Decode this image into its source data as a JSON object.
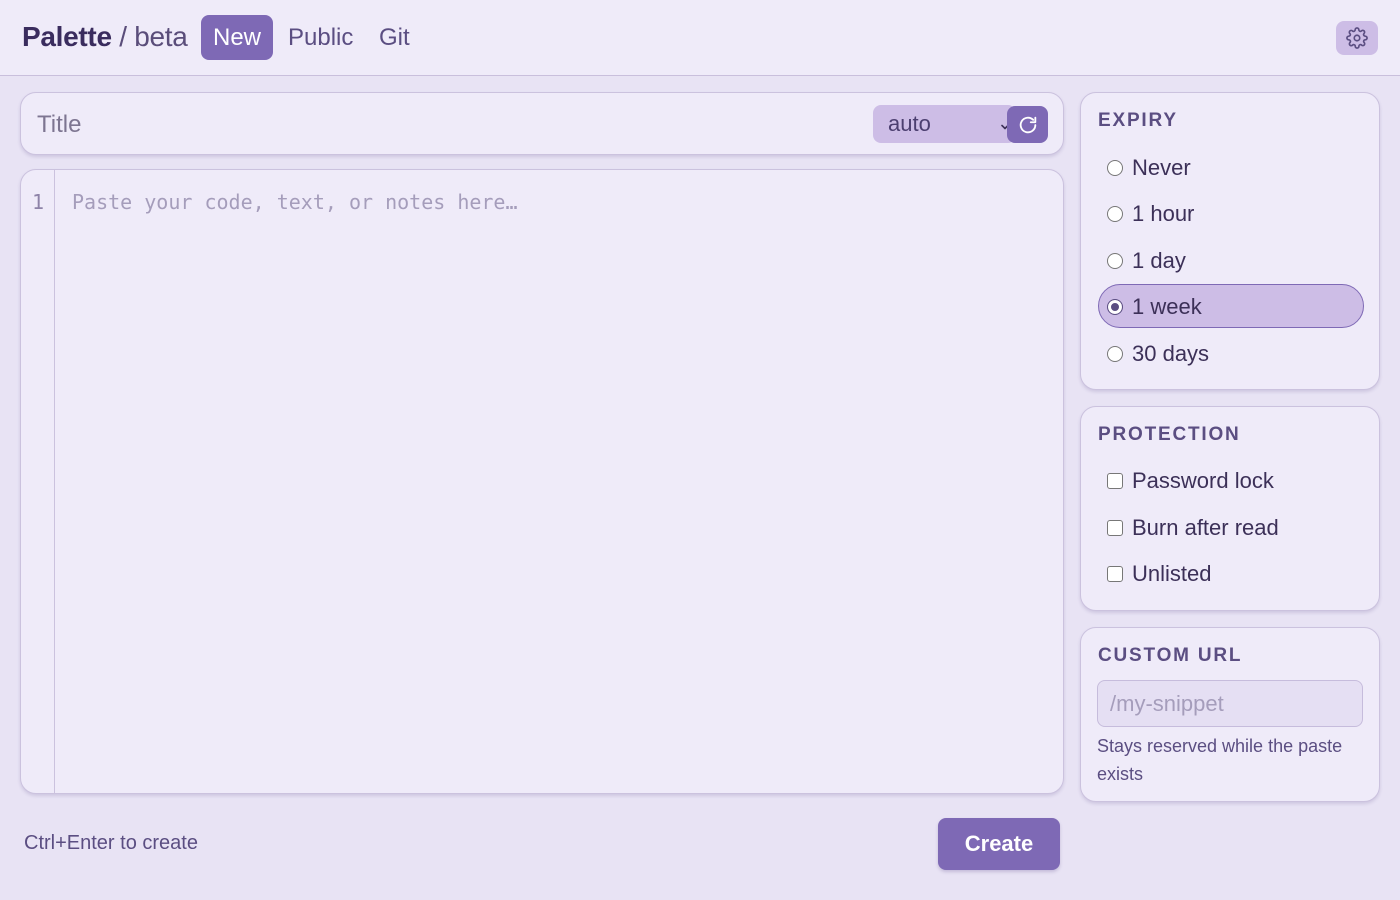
{
  "header": {
    "brand_name": "Palette",
    "brand_sep": " / ",
    "brand_tag": "beta",
    "tabs": [
      {
        "label": "New",
        "active": true
      },
      {
        "label": "Public",
        "active": false
      },
      {
        "label": "Git",
        "active": false
      }
    ],
    "settings_icon": "gear-icon"
  },
  "editor": {
    "title_placeholder": "Title",
    "language": "auto",
    "refresh_icon": "refresh-icon",
    "line_number": "1",
    "placeholder": "Paste your code, text, or notes here…"
  },
  "footer": {
    "hint": "Ctrl+Enter to create",
    "create_label": "Create"
  },
  "sidebar": {
    "expiry": {
      "title": "EXPIRY",
      "selected": "1 week",
      "options": [
        "Never",
        "1 hour",
        "1 day",
        "1 week",
        "30 days"
      ]
    },
    "protection": {
      "title": "PROTECTION",
      "options": [
        {
          "label": "Password lock",
          "checked": false
        },
        {
          "label": "Burn after read",
          "checked": false
        },
        {
          "label": "Unlisted",
          "checked": false
        }
      ]
    },
    "custom_url": {
      "title": "CUSTOM URL",
      "placeholder": "/my-snippet",
      "help": "Stays reserved while the paste exists"
    }
  },
  "colors": {
    "accent": "#7e69b5",
    "accent_light": "#cdbde6",
    "background": "#e8e3f4",
    "card": "#efebf9"
  }
}
